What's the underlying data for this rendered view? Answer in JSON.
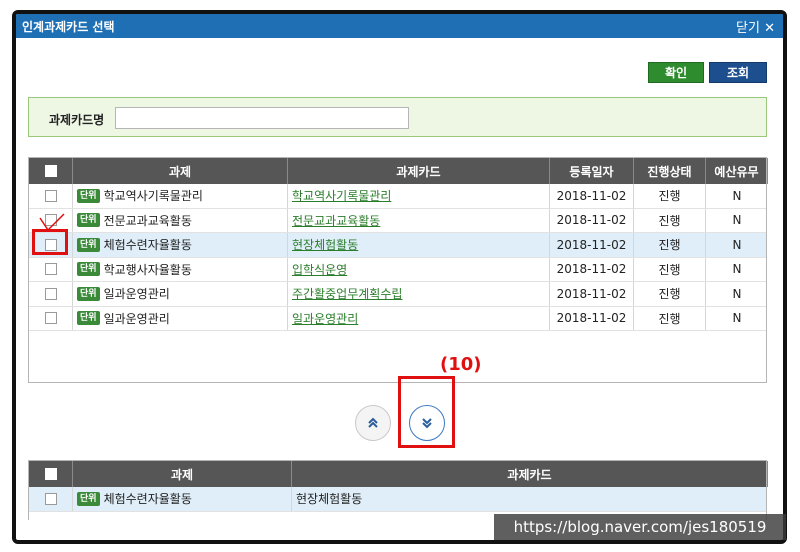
{
  "window": {
    "title": "인계과제카드 선택",
    "close_label": "닫기",
    "close_glyph": "✕"
  },
  "toolbar": {
    "confirm_label": "확인",
    "search_label": "조회"
  },
  "search": {
    "label": "과제카드명",
    "value": ""
  },
  "table1": {
    "headers": [
      "과제",
      "과제카드",
      "등록일자",
      "진행상태",
      "예산유무"
    ],
    "rows": [
      {
        "badge": "단위",
        "task": "학교역사기록물관리",
        "card": "학교역사기록물관리",
        "date": "2018-11-02",
        "status": "진행",
        "budget": "N"
      },
      {
        "badge": "단위",
        "task": "전문교과교육활동",
        "card": "전문교과교육활동",
        "date": "2018-11-02",
        "status": "진행",
        "budget": "N"
      },
      {
        "badge": "단위",
        "task": "체험수련자율활동",
        "card": "현장체험활동",
        "date": "2018-11-02",
        "status": "진행",
        "budget": "N"
      },
      {
        "badge": "단위",
        "task": "학교행사자율활동",
        "card": "입학식운영",
        "date": "2018-11-02",
        "status": "진행",
        "budget": "N"
      },
      {
        "badge": "단위",
        "task": "일과운영관리",
        "card": "주간활중업무계획수립",
        "date": "2018-11-02",
        "status": "진행",
        "budget": "N"
      },
      {
        "badge": "단위",
        "task": "일과운영관리",
        "card": "일과운영관리",
        "date": "2018-11-02",
        "status": "진행",
        "budget": "N"
      }
    ]
  },
  "table2": {
    "headers": [
      "과제",
      "과제카드"
    ],
    "rows": [
      {
        "badge": "단위",
        "task": "체험수련자율활동",
        "card": "현장체험활동"
      }
    ]
  },
  "annotation": {
    "text": "(10)"
  },
  "watermark": {
    "text": "https://blog.naver.com/jes180519"
  },
  "icons": {
    "move_up": "chevron-double-up-icon",
    "move_down": "chevron-double-down-icon"
  },
  "colors": {
    "titlebar": "#1f6fb5",
    "confirm": "#2e8b2e",
    "search": "#1d4f8f",
    "annotation": "#e01010"
  }
}
